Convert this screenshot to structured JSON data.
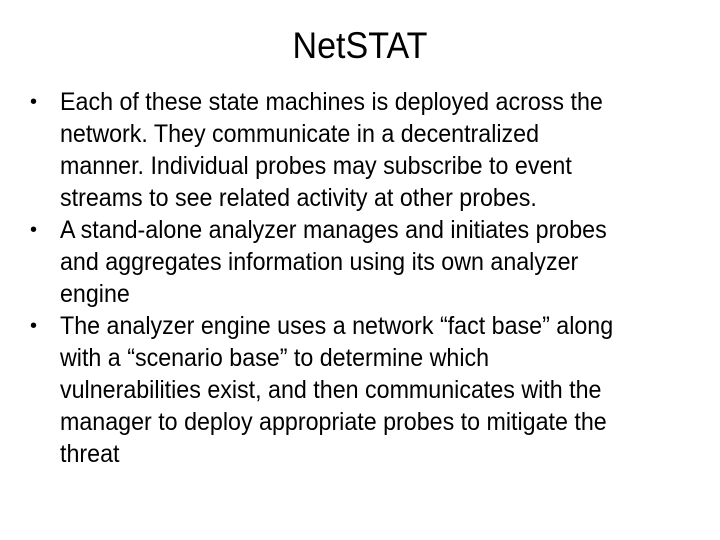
{
  "slide": {
    "title": "NetSTAT",
    "bullet_glyph": "•",
    "bullets": [
      {
        "lines": [
          "Each of these state machines is deployed across the",
          "network.  They communicate in a decentralized",
          "manner.  Individual probes may subscribe to event",
          "streams to see related activity at other probes."
        ]
      },
      {
        "lines": [
          "A stand-alone analyzer manages and initiates probes",
          "and aggregates information using its own analyzer",
          "engine"
        ]
      },
      {
        "lines": [
          "The analyzer engine uses a network “fact base” along",
          "with a “scenario base” to determine which",
          "vulnerabilities exist, and then communicates with the",
          "manager to deploy appropriate probes to mitigate the",
          "threat"
        ]
      }
    ]
  }
}
